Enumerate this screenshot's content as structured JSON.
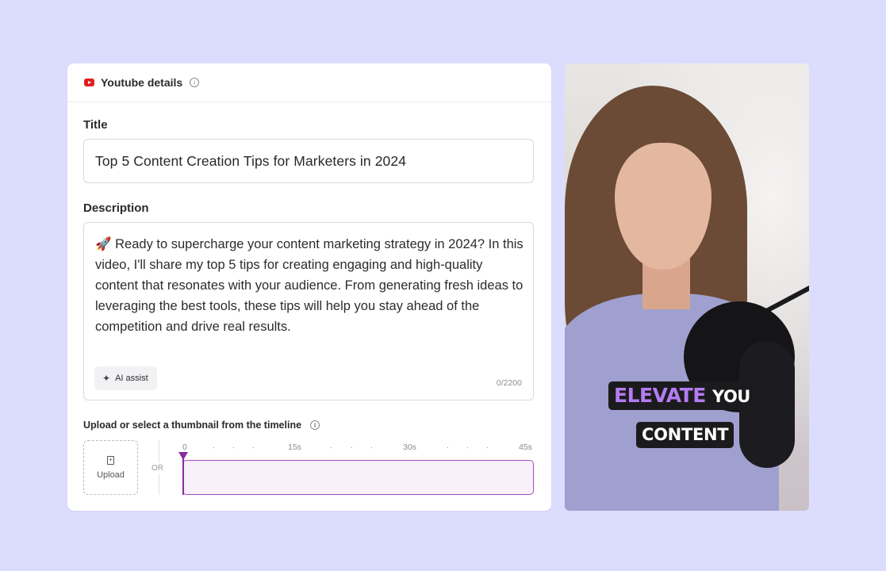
{
  "header": {
    "title": "Youtube details",
    "info_icon": "info-icon"
  },
  "title_field": {
    "label": "Title",
    "value": "Top 5 Content Creation Tips for Marketers in 2024"
  },
  "description_field": {
    "label": "Description",
    "value": "🚀 Ready to supercharge your content marketing strategy in 2024? In this video, I'll share my top 5 tips for creating engaging and high-quality content that resonates with your audience. From generating fresh ideas to leveraging the best tools, these tips will help you stay ahead of the competition and drive real results.",
    "ai_assist_label": "AI assist",
    "char_count": "0/2200"
  },
  "thumbnail": {
    "label": "Upload or select a thumbnail from the timeline",
    "upload_label": "Upload",
    "or_label": "OR",
    "timeline_ticks": [
      "0",
      "15s",
      "30s",
      "45s"
    ],
    "playhead_seconds": 0
  },
  "preview": {
    "caption_line1_accent": "ELEVATE",
    "caption_line1_rest": "YOU",
    "caption_line2": "CONTENT"
  },
  "colors": {
    "background": "#dcdcfe",
    "youtube_red": "#e02020",
    "accent_purple": "#8c2aa0",
    "caption_purple": "#b57cf2"
  }
}
